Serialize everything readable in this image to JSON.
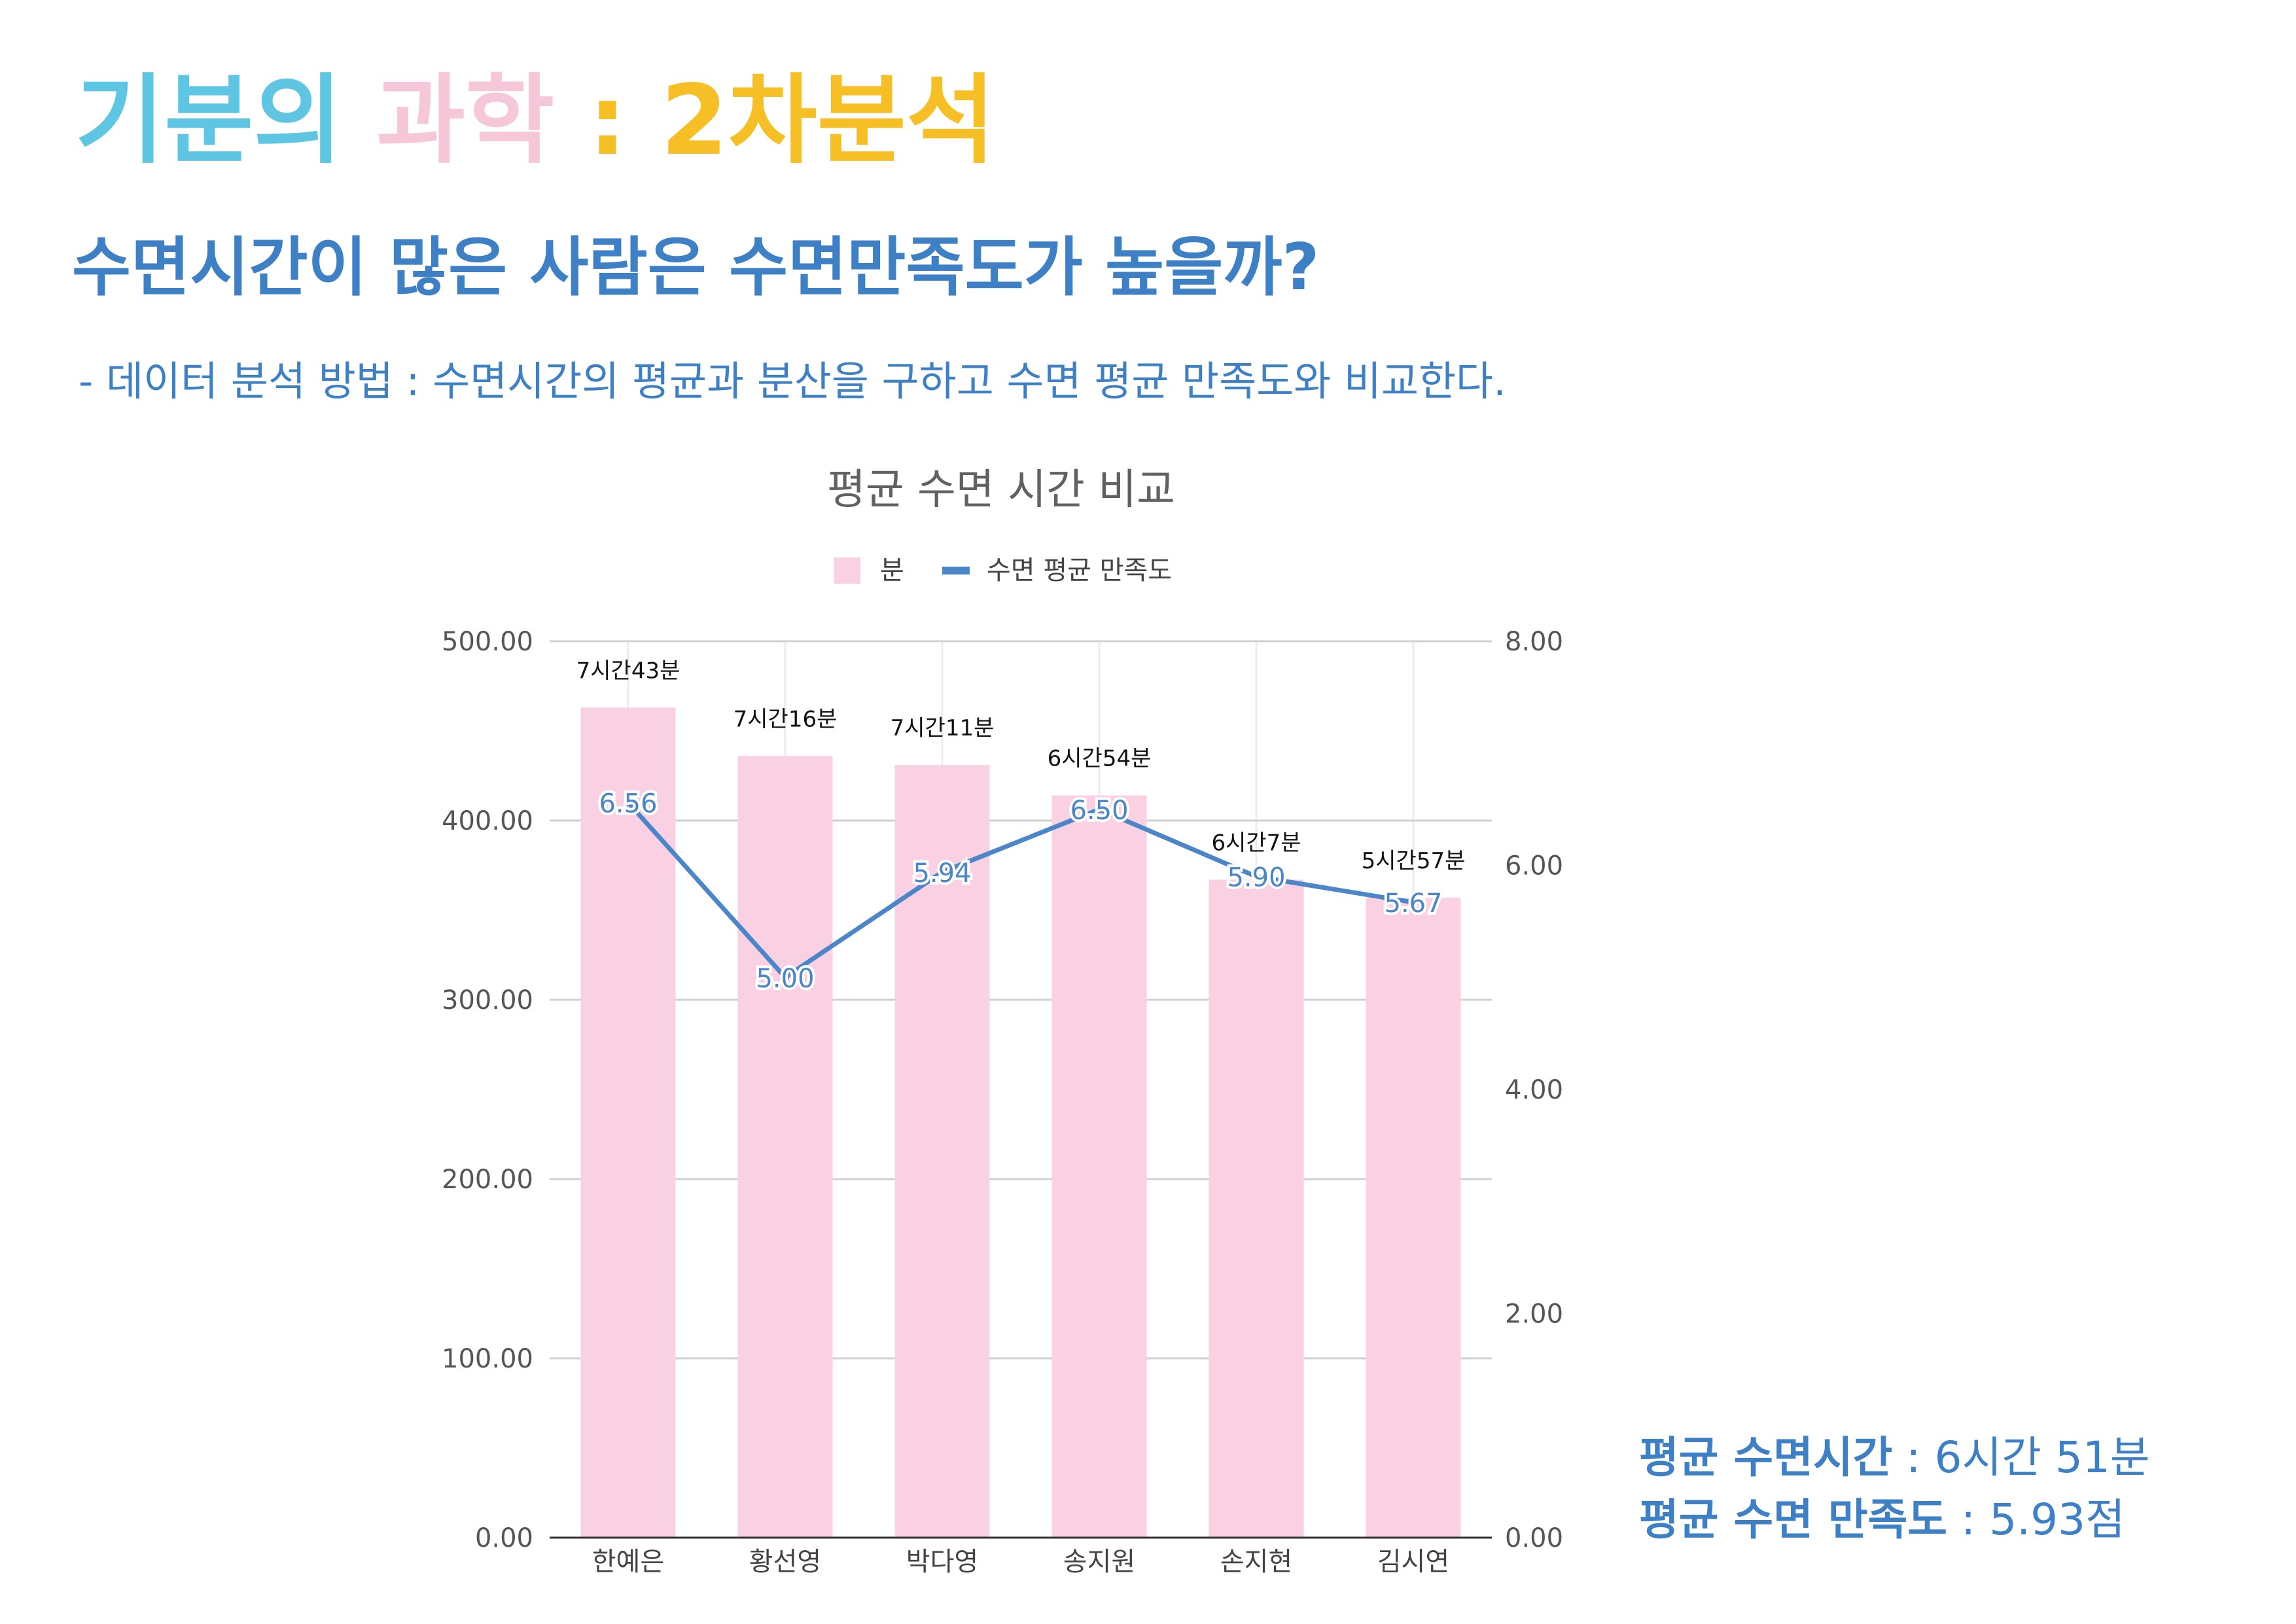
{
  "header": {
    "title_part1": "기분의 ",
    "title_part2": "과학",
    "title_part3": " : 2차분석",
    "question": "수면시간이 많은 사람은 수면만족도가 높을까?",
    "method": "- 데이터 분석 방법 : 수면시간의 평균과 분산을 구하고 수면 평균 만족도와 비교한다."
  },
  "colors": {
    "title1": "#5ec6e3",
    "title2": "#f6c6d9",
    "title3": "#f6bf26",
    "bar": "#f9d1e3",
    "line": "#4a86c8",
    "text_blue": "#3d80c6"
  },
  "chart_data": {
    "type": "bar",
    "title": "평균 수면 시간 비교",
    "categories": [
      "한예은",
      "황선영",
      "박다영",
      "송지원",
      "손지현",
      "김시연"
    ],
    "series": [
      {
        "name": "분",
        "type": "bar",
        "axis": "left",
        "values": [
          463,
          436,
          431,
          414,
          367,
          357
        ],
        "labels": [
          "7시간43분",
          "7시간16분",
          "7시간11분",
          "6시간54분",
          "6시간7분",
          "5시간57분"
        ]
      },
      {
        "name": "수면 평균 만족도",
        "type": "line",
        "axis": "right",
        "values": [
          6.56,
          5.0,
          5.94,
          6.5,
          5.9,
          5.67
        ],
        "labels": [
          "6.56",
          "5.00",
          "5.94",
          "6.50",
          "5.90",
          "5.67"
        ]
      }
    ],
    "left_axis": {
      "min": 0,
      "max": 500,
      "ticks": [
        "0.00",
        "100.00",
        "200.00",
        "300.00",
        "400.00",
        "500.00"
      ]
    },
    "right_axis": {
      "min": 0,
      "max": 8,
      "ticks": [
        "0.00",
        "2.00",
        "4.00",
        "6.00",
        "8.00"
      ]
    },
    "legend": "top",
    "grid": true
  },
  "summary": {
    "sleep_label": "평균 수면시간",
    "sleep_value": " : 6시간 51분",
    "satisfaction_label": "평균 수면 만족도",
    "satisfaction_value": " : 5.93점"
  }
}
